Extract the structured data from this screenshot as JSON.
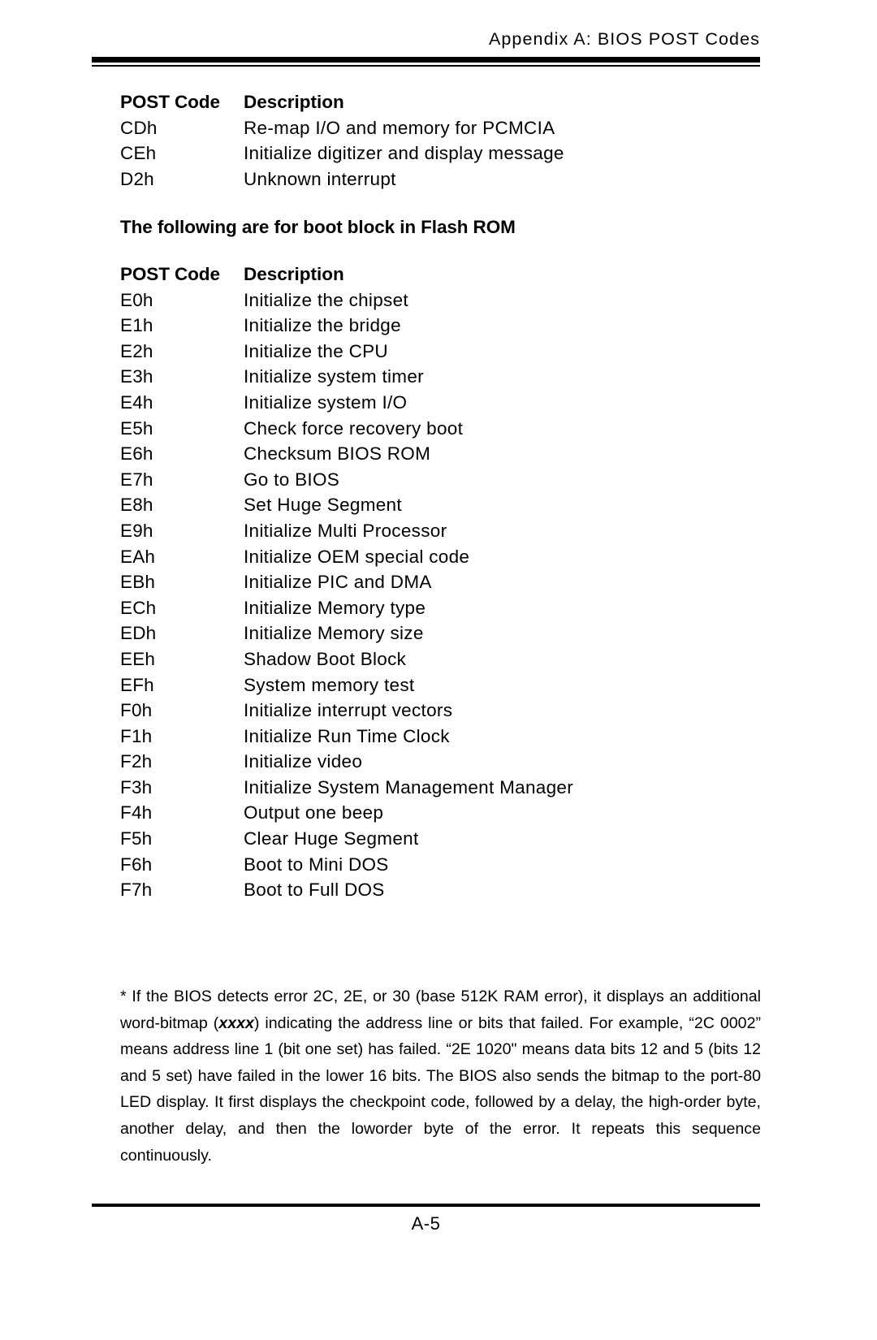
{
  "header": {
    "running_head": "Appendix A: BIOS POST Codes"
  },
  "table_one": {
    "headers": {
      "code": "POST Code",
      "description": "Description"
    },
    "rows": [
      {
        "code": "CDh",
        "description": "Re-map I/O and memory for PCMCIA"
      },
      {
        "code": "CEh",
        "description": "Initialize digitizer and display message"
      },
      {
        "code": "D2h",
        "description": "Unknown interrupt"
      }
    ]
  },
  "section_heading": "The following are for boot block in Flash ROM",
  "table_two": {
    "headers": {
      "code": "POST Code",
      "description": "Description"
    },
    "rows": [
      {
        "code": "E0h",
        "description": "Initialize the chipset"
      },
      {
        "code": "E1h",
        "description": "Initialize the bridge"
      },
      {
        "code": "E2h",
        "description": "Initialize the CPU"
      },
      {
        "code": "E3h",
        "description": "Initialize system timer"
      },
      {
        "code": "E4h",
        "description": "Initialize system I/O"
      },
      {
        "code": "E5h",
        "description": "Check force recovery boot"
      },
      {
        "code": "E6h",
        "description": "Checksum BIOS ROM"
      },
      {
        "code": "E7h",
        "description": "Go to BIOS"
      },
      {
        "code": "E8h",
        "description": "Set Huge Segment"
      },
      {
        "code": "E9h",
        "description": "Initialize Multi Processor"
      },
      {
        "code": "EAh",
        "description": "Initialize OEM special code"
      },
      {
        "code": "EBh",
        "description": "Initialize PIC and DMA"
      },
      {
        "code": "ECh",
        "description": "Initialize Memory type"
      },
      {
        "code": "EDh",
        "description": "Initialize Memory size"
      },
      {
        "code": "EEh",
        "description": "Shadow Boot Block"
      },
      {
        "code": "EFh",
        "description": "System memory test"
      },
      {
        "code": "F0h",
        "description": "Initialize interrupt vectors"
      },
      {
        "code": "F1h",
        "description": "Initialize Run Time Clock"
      },
      {
        "code": "F2h",
        "description": "Initialize video"
      },
      {
        "code": "F3h",
        "description": "Initialize System Management Manager"
      },
      {
        "code": "F4h",
        "description": "Output one beep"
      },
      {
        "code": "F5h",
        "description": "Clear Huge Segment"
      },
      {
        "code": "F6h",
        "description": "Boot to Mini DOS"
      },
      {
        "code": "F7h",
        "description": "Boot to Full DOS"
      }
    ]
  },
  "footnote": {
    "part_1": "* If the BIOS detects error 2C, 2E, or 30 (base 512K RAM error), it displays an additional word-bitmap (",
    "emphasis": "xxxx",
    "part_2": ") indicating the address line or bits that failed.  For example, “2C 0002” means address line 1 (bit one set) has failed.  “2E 1020\" means data bits 12 and 5 (bits 12 and 5 set) have failed in the lower 16 bits.  The BIOS also sends the bitmap to the port-80 LED display.  It first displays the checkpoint code, followed by a delay, the high-order byte, another delay, and then the loworder byte of the error.  It repeats this sequence continuously."
  },
  "footer": {
    "page_number": "A-5"
  }
}
